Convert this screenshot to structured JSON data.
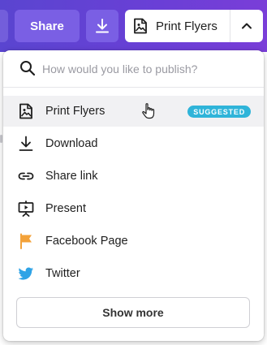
{
  "topbar": {
    "share_label": "Share",
    "publish_label": "Print Flyers",
    "accent_color": "#6a3fd6"
  },
  "search": {
    "placeholder": "How would you like to publish?"
  },
  "items": [
    {
      "label": "Print Flyers",
      "icon": "print-flyers-icon",
      "badge": "SUGGESTED"
    },
    {
      "label": "Download",
      "icon": "download-icon"
    },
    {
      "label": "Share link",
      "icon": "link-icon"
    },
    {
      "label": "Present",
      "icon": "present-icon"
    },
    {
      "label": "Facebook Page",
      "icon": "facebook-flag-icon"
    },
    {
      "label": "Twitter",
      "icon": "twitter-bird-icon"
    }
  ],
  "show_more_label": "Show more",
  "colors": {
    "badge": "#2fb4d9",
    "facebook_flag": "#f3a23a",
    "twitter": "#2fa3e6"
  }
}
